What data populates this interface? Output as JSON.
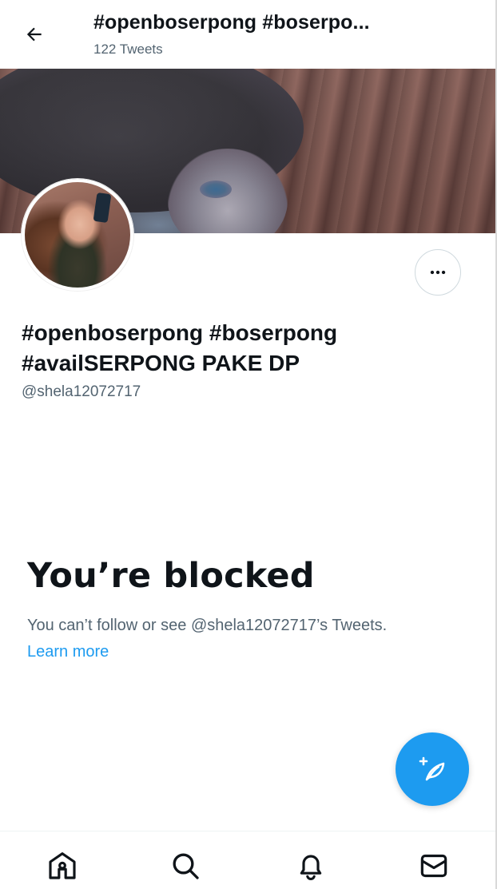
{
  "header": {
    "title": "#openboserpong #boserpo...",
    "tweet_count": "122 Tweets",
    "back_icon": "back-arrow-icon"
  },
  "profile": {
    "display_name_line1": "#openboserpong #boserpong",
    "display_name_line2": "#availSERPONG PAKE DP",
    "handle": "@shela12072717",
    "more_icon": "more-horizontal-icon"
  },
  "blocked": {
    "title": "You’re blocked",
    "message": "You can’t follow or see @shela12072717’s Tweets.",
    "link": "Learn more"
  },
  "compose": {
    "icon": "compose-tweet-icon",
    "color": "#1d9bf0"
  },
  "bottom_nav": {
    "items": [
      {
        "icon": "home-icon"
      },
      {
        "icon": "search-icon"
      },
      {
        "icon": "notifications-bell-icon"
      },
      {
        "icon": "messages-mail-icon"
      }
    ]
  },
  "colors": {
    "accent": "#1d9bf0",
    "text_primary": "#0f1419",
    "text_secondary": "#536471"
  }
}
